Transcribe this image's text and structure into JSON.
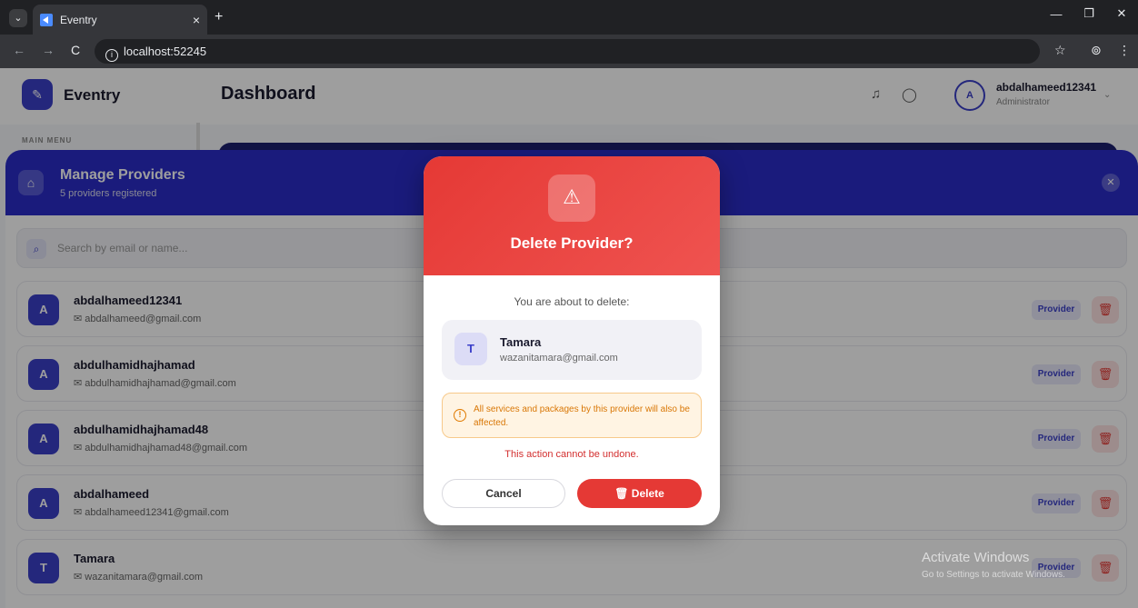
{
  "browser": {
    "tab_title": "Eventry",
    "tab_close": "×",
    "new_tab": "+",
    "url": "localhost:52245",
    "info_glyph": "i",
    "back": "←",
    "forward": "→",
    "reload": "C",
    "star": "☆",
    "profile": "⊚",
    "menu": "⋮",
    "dropdown": "⌄",
    "minimize": "—",
    "restore": "❐",
    "close": "✕"
  },
  "header": {
    "logo_glyph": "✎",
    "app_name": "Eventry",
    "page_title": "Dashboard",
    "bell_icon": "♫",
    "chat_icon": "◯",
    "user_initial": "A",
    "username": "abdalhameed12341",
    "role": "Administrator",
    "chevron": "⌄"
  },
  "sidebar": {
    "section_label": "MAIN MENU"
  },
  "sheet": {
    "title": "Manage Providers",
    "subtitle": "5 providers registered",
    "icon": "⌂",
    "close": "✕",
    "search_placeholder": "Search by email or name...",
    "search_icon": "⌕",
    "email_icon": "✉",
    "delete_icon": "🗑",
    "rows": [
      {
        "initial": "A",
        "name": "abdalhameed12341",
        "email": "abdalhameed@gmail.com",
        "badge": "Provider"
      },
      {
        "initial": "A",
        "name": "abdulhamidhajhamad",
        "email": "abdulhamidhajhamad@gmail.com",
        "badge": "Provider"
      },
      {
        "initial": "A",
        "name": "abdulhamidhajhamad48",
        "email": "abdulhamidhajhamad48@gmail.com",
        "badge": "Provider"
      },
      {
        "initial": "A",
        "name": "abdalhameed",
        "email": "abdalhameed12341@gmail.com",
        "badge": "Provider"
      },
      {
        "initial": "T",
        "name": "Tamara",
        "email": "wazanitamara@gmail.com",
        "badge": "Provider"
      }
    ]
  },
  "dialog": {
    "warning_icon": "⚠",
    "title": "Delete Provider?",
    "about_text": "You are about to delete:",
    "provider_initial": "T",
    "provider_name": "Tamara",
    "provider_email": "wazanitamara@gmail.com",
    "notice_icon": "!",
    "notice_text": "All services and packages by this provider will also be affected.",
    "undone_text": "This action cannot be undone.",
    "cancel_label": "Cancel",
    "delete_label": "🗑 Delete"
  },
  "os": {
    "watermark_title": "Activate Windows",
    "watermark_sub": "Go to Settings to activate Windows."
  },
  "colors": {
    "brand": "#2a2dc9",
    "danger": "#e53935",
    "warning": "#d97706"
  }
}
